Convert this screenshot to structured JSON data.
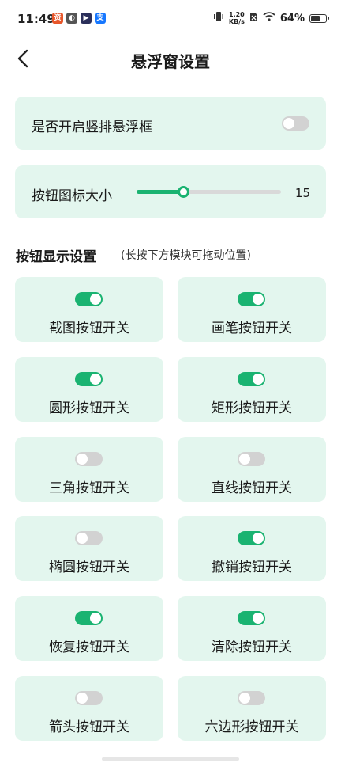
{
  "status_bar": {
    "time": "11:49",
    "app_icons": [
      {
        "name": "app-icon-red",
        "glyph": "资",
        "color": "#e8562a"
      },
      {
        "name": "app-icon-gray",
        "glyph": "◐",
        "color": "#555555"
      },
      {
        "name": "app-icon-dark",
        "glyph": "▶",
        "color": "#2b2f5a"
      },
      {
        "name": "app-icon-blue",
        "glyph": "支",
        "color": "#1677ff"
      }
    ],
    "net_speed_value": "1.20",
    "net_speed_unit": "KB/s",
    "battery_level": 64,
    "battery_text": "64%"
  },
  "header": {
    "title": "悬浮窗设置"
  },
  "vertical_float": {
    "label": "是否开启竖排悬浮框",
    "enabled": false
  },
  "icon_size": {
    "label": "按钮图标大小",
    "value": "15",
    "fraction": 0.32
  },
  "section": {
    "title": "按钮显示设置",
    "hint": "(长按下方模块可拖动位置)"
  },
  "buttons": [
    {
      "label": "截图按钮开关",
      "on": true
    },
    {
      "label": "画笔按钮开关",
      "on": true
    },
    {
      "label": "圆形按钮开关",
      "on": true
    },
    {
      "label": "矩形按钮开关",
      "on": true
    },
    {
      "label": "三角按钮开关",
      "on": false
    },
    {
      "label": "直线按钮开关",
      "on": false
    },
    {
      "label": "椭圆按钮开关",
      "on": false
    },
    {
      "label": "撤销按钮开关",
      "on": true
    },
    {
      "label": "恢复按钮开关",
      "on": true
    },
    {
      "label": "清除按钮开关",
      "on": true
    },
    {
      "label": "箭头按钮开关",
      "on": false
    },
    {
      "label": "六边形按钮开关",
      "on": false
    }
  ],
  "colors": {
    "accent": "#1ab371",
    "card_bg": "#e3f6ee",
    "toggle_off": "#d2d2d2"
  }
}
